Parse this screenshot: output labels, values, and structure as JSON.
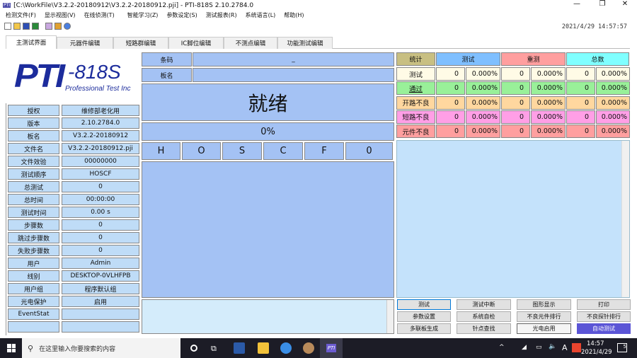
{
  "window": {
    "title": "[C:\\WorkFile\\V3.2.2-20180912\\V3.2.2-20180912.pji] - PTI-818S 2.10.2784.0",
    "app_icon": "PTI"
  },
  "menu": [
    "检测文件(F)",
    "显示视图(V)",
    "在线侦测(T)",
    "智能学习(Z)",
    "参数设定(S)",
    "测试报表(R)",
    "系统语言(L)",
    "帮助(H)"
  ],
  "toolbar": {
    "icons": [
      "new-icon",
      "open-icon",
      "save-icon",
      "save-as-icon",
      "export-icon",
      "grid-icon",
      "info-icon"
    ],
    "datetime": "2021/4/29  14:57:57"
  },
  "tabs": [
    "主测试界面",
    "元器件编辑",
    "短路群编辑",
    "IC脚位编辑",
    "不测点编辑",
    "功能测试编辑"
  ],
  "logo": {
    "brand": "PTI",
    "model": "-818S",
    "tagline": "Professional Test Inc"
  },
  "info": [
    {
      "label": "授权",
      "value": "维修部老化用"
    },
    {
      "label": "版本",
      "value": "2.10.2784.0"
    },
    {
      "label": "板名",
      "value": "V3.2.2-20180912"
    },
    {
      "label": "文件名",
      "value": "V3.2.2-20180912.pji"
    },
    {
      "label": "文件效验",
      "value": "00000000"
    },
    {
      "label": "测试顺序",
      "value": "HOSCF"
    },
    {
      "label": "总测试",
      "value": "0"
    },
    {
      "label": "总时间",
      "value": "00:00:00"
    },
    {
      "label": "测试时间",
      "value": "0.00 s"
    },
    {
      "label": "步骤数",
      "value": "0"
    },
    {
      "label": "跳过步骤数",
      "value": "0"
    },
    {
      "label": "失败步骤数",
      "value": "0"
    },
    {
      "label": "用户",
      "value": "Admin"
    },
    {
      "label": "线别",
      "value": "DESKTOP-0VLHFPB"
    },
    {
      "label": "用户组",
      "value": "程序默认组"
    },
    {
      "label": "光电保护",
      "value": "启用"
    },
    {
      "label": "EventStat",
      "value": ""
    },
    {
      "label": "",
      "value": ""
    }
  ],
  "center": {
    "barcode_label": "条码",
    "barcode_value": "_",
    "board_label": "板名",
    "board_value": "",
    "status": "就绪",
    "progress": "0%",
    "steps": [
      "H",
      "O",
      "S",
      "C",
      "F",
      "0"
    ]
  },
  "stats": {
    "headers": [
      "统计",
      "测试",
      "重测",
      "总数"
    ],
    "header_colors": [
      "#c8bf82",
      "#7fbfff",
      "#ff9f9f",
      "#80ffff"
    ],
    "rows": [
      {
        "label": "测试",
        "color": "#fffbe6",
        "values": [
          "0",
          "0.000%",
          "0",
          "0.000%",
          "0",
          "0.000%"
        ]
      },
      {
        "label": "通过",
        "color": "#99f099",
        "values": [
          "0",
          "0.000%",
          "0",
          "0.000%",
          "0",
          "0.000%"
        ]
      },
      {
        "label": "开路不良",
        "color": "#ffd79f",
        "values": [
          "0",
          "0.000%",
          "0",
          "0.000%",
          "0",
          "0.000%"
        ]
      },
      {
        "label": "短路不良",
        "color": "#ff9fe6",
        "values": [
          "0",
          "0.000%",
          "0",
          "0.000%",
          "0",
          "0.000%"
        ]
      },
      {
        "label": "元件不良",
        "color": "#ff9f9f",
        "values": [
          "0",
          "0.000%",
          "0",
          "0.000%",
          "0",
          "0.000%"
        ]
      }
    ]
  },
  "buttons": [
    [
      "测试",
      "测试中断",
      "图形显示",
      "打印"
    ],
    [
      "参数设置",
      "系统自检",
      "不良元件排行",
      "不良探针排行"
    ],
    [
      "多联板生成",
      "针点查找",
      "光电启用",
      "自动测试"
    ]
  ],
  "taskbar": {
    "search_placeholder": "在这里输入你要搜索的内容",
    "time": "14:57",
    "date": "2021/4/29",
    "ime": "A",
    "notification_count": "5"
  }
}
